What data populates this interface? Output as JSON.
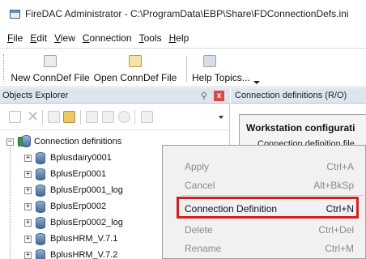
{
  "window": {
    "title": "FireDAC Administrator - C:\\ProgramData\\EBP\\Share\\FDConnectionDefs.ini",
    "icon": "app-window-icon"
  },
  "menubar": {
    "items": [
      {
        "accel": "F",
        "rest": "ile"
      },
      {
        "accel": "E",
        "rest": "dit"
      },
      {
        "accel": "V",
        "rest": "iew"
      },
      {
        "accel": "C",
        "rest": "onnection"
      },
      {
        "accel": "T",
        "rest": "ools"
      },
      {
        "accel": "H",
        "rest": "elp"
      }
    ]
  },
  "toolbar": {
    "new_conndef": "New ConnDef File",
    "open_conndef": "Open ConnDef File",
    "help_topics": "Help Topics..."
  },
  "objects_explorer": {
    "title": "Objects Explorer",
    "pin_icon": "pin-icon",
    "close_label": "x",
    "tree": {
      "root": "Connection definitions",
      "items": [
        "Bplusdairy0001",
        "BplusErp0001",
        "BplusErp0001_log",
        "BplusErp0002",
        "BplusErp0002_log",
        "BplusHRM_V.7.1",
        "BplusHRM_V.7.2"
      ]
    }
  },
  "right_pane": {
    "title": "Connection definitions (R/O)",
    "section_title": "Workstation configurati",
    "field_label": "Connection definition file"
  },
  "context_menu": {
    "items": [
      {
        "label": "Apply",
        "shortcut": "Ctrl+A",
        "enabled": false
      },
      {
        "label": "Cancel",
        "shortcut": "Alt+BkSp",
        "enabled": false
      },
      {
        "label": "Connection Definition",
        "shortcut": "Ctrl+N",
        "enabled": true,
        "highlighted": true
      },
      {
        "label": "Delete",
        "shortcut": "Ctrl+Del",
        "enabled": false
      },
      {
        "label": "Rename",
        "shortcut": "Ctrl+M",
        "enabled": false
      }
    ],
    "highlight_color": "#d62020"
  }
}
